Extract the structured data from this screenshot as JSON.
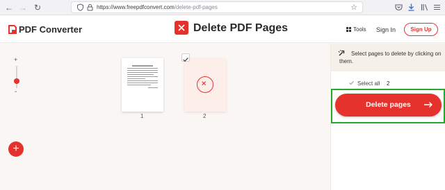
{
  "browser": {
    "url_host": "https://www.freepdfconvert.com",
    "url_path": "/delete-pdf-pages"
  },
  "header": {
    "logo_text": "PDF Converter",
    "tool_title": "Delete PDF Pages",
    "tools_label": "Tools",
    "signin_label": "Sign In",
    "signup_label": "Sign Up"
  },
  "canvas": {
    "zoom_plus": "+",
    "zoom_minus": "-",
    "add_label": "+",
    "pages": [
      {
        "number": "1",
        "marked_for_deletion": false
      },
      {
        "number": "2",
        "marked_for_deletion": true
      }
    ]
  },
  "panel": {
    "hint": "Select pages to delete by clicking on them.",
    "select_all_label": "Select all",
    "selected_count": "2",
    "delete_label": "Delete pages"
  },
  "colors": {
    "accent": "#e5322d",
    "highlight": "#2aa52e",
    "hint_bg": "#f6f1e8"
  }
}
